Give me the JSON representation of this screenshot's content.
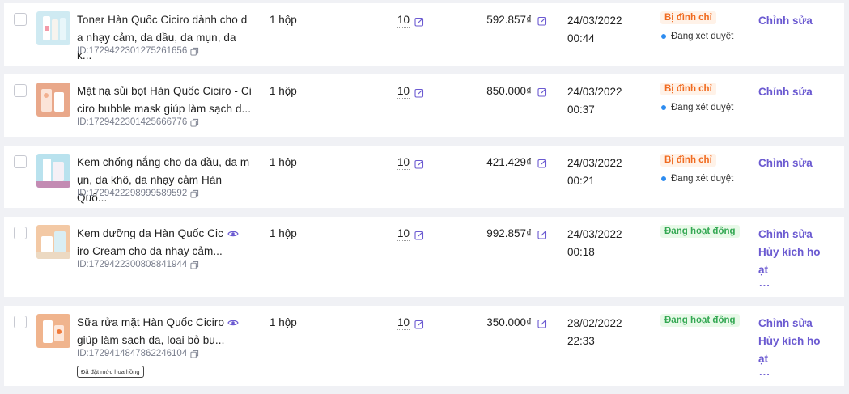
{
  "products": [
    {
      "name_line1": "Toner Hàn Quốc Ciciro dành cho d",
      "name_line2": "a nhạy cảm, da dầu, da mụn, da k...",
      "id": "ID:1729422301275261656",
      "unit": "1 hộp",
      "qty": "10",
      "price": "592.857₫",
      "date": "24/03/2022",
      "time": "00:44",
      "status": "Bị đình chỉ",
      "review": "Đang xét duyệt",
      "action1": "Chỉnh sửa"
    },
    {
      "name_line1": "Mặt nạ sủi bọt Hàn Quốc Ciciro - Ci",
      "name_line2": "ciro bubble mask giúp làm sạch d...",
      "id": "ID:1729422301425666776",
      "unit": "1 hộp",
      "qty": "10",
      "price": "850.000₫",
      "date": "24/03/2022",
      "time": "00:37",
      "status": "Bị đình chỉ",
      "review": "Đang xét duyệt",
      "action1": "Chỉnh sửa"
    },
    {
      "name_line1": "Kem chống nắng cho da dầu, da m",
      "name_line2": "ụn, da khô, da nhạy cảm Hàn Quố...",
      "id": "ID:1729422298999589592",
      "unit": "1 hộp",
      "qty": "10",
      "price": "421.429₫",
      "date": "24/03/2022",
      "time": "00:21",
      "status": "Bị đình chỉ",
      "review": "Đang xét duyệt",
      "action1": "Chỉnh sửa"
    },
    {
      "name_line1": "Kem dưỡng da Hàn Quốc Cic",
      "name_line2": "iro Cream cho da nhạy cảm...",
      "id": "ID:1729422300808841944",
      "unit": "1 hộp",
      "qty": "10",
      "price": "992.857₫",
      "date": "24/03/2022",
      "time": "00:18",
      "status": "Đang hoạt động",
      "action1": "Chỉnh sửa",
      "action2_line1": "Hủy kích ho",
      "action2_line2": "ạt",
      "more": "..."
    },
    {
      "name_line1": "Sữa rửa mặt Hàn Quốc Ciciro",
      "name_line2": "giúp làm sạch da, loại bỏ bụ...",
      "id": "ID:1729414847862246104",
      "badge": "Đã đặt mức hoa hồng",
      "unit": "1 hộp",
      "qty": "10",
      "price": "350.000₫",
      "date": "28/02/2022",
      "time": "22:33",
      "status": "Đang hoạt động",
      "action1": "Chỉnh sửa",
      "action2_line1": "Hủy kích ho",
      "action2_line2": "ạt",
      "more": "..."
    }
  ],
  "colors": {
    "accent": "#6b5ad1",
    "suspended": "#f06a1f",
    "active": "#34a853",
    "review_dot": "#2d8cf0"
  }
}
